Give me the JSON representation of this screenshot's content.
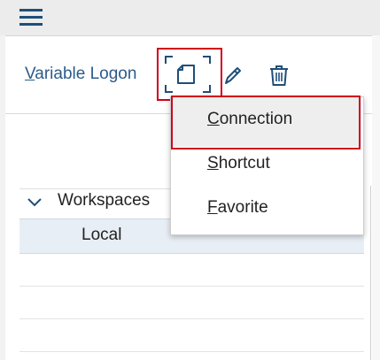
{
  "header": {
    "menu_icon": "hamburger-menu-icon"
  },
  "toolbar": {
    "variable_logon_first": "V",
    "variable_logon_rest": "ariable Logon",
    "new_icon": "new-document-icon",
    "edit_icon": "pencil-icon",
    "delete_icon": "trash-icon"
  },
  "dropdown": {
    "items": [
      {
        "mnemonic": "C",
        "rest": "onnection",
        "highlighted": true
      },
      {
        "mnemonic": "S",
        "rest": "hortcut"
      },
      {
        "mnemonic": "F",
        "rest": "avorite"
      }
    ]
  },
  "workspaces": {
    "title": "Workspaces",
    "local_label": "Local",
    "chevron_icon": "chevron-down-icon"
  },
  "colors": {
    "accent_red": "#d0021b",
    "link_blue": "#2b5c8a",
    "icon_blue": "#1f4e79"
  }
}
